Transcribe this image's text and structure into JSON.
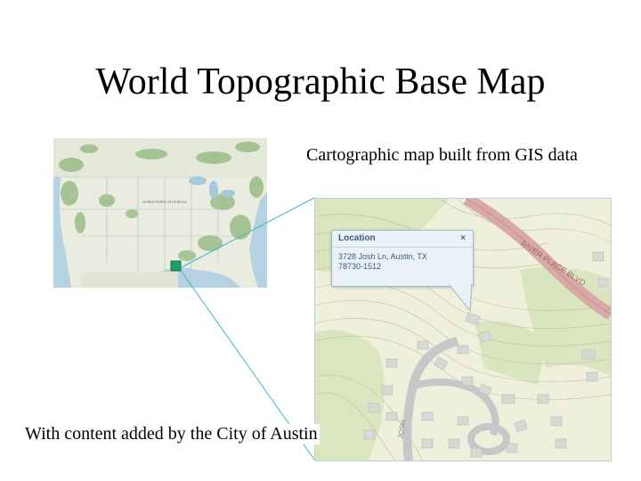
{
  "slide": {
    "title": "World Topographic Base Map",
    "caption_top": "Cartographic map built from GIS data",
    "caption_bottom": "With content added by the City of Austin"
  },
  "overview_map": {
    "labels": [
      "United States of America"
    ],
    "highlight_color": "#1e9e6b"
  },
  "detail_map": {
    "road_label": "RIVER PLACE BLVD",
    "street_label": "JOSH",
    "popup": {
      "title": "Location",
      "close": "×",
      "address_line1": "3728 Josh Ln, Austin, TX",
      "address_line2": "78730-1512"
    }
  },
  "colors": {
    "connector": "#3fb5c9",
    "land": "#eef0dc",
    "road": "#d9a9a6"
  }
}
